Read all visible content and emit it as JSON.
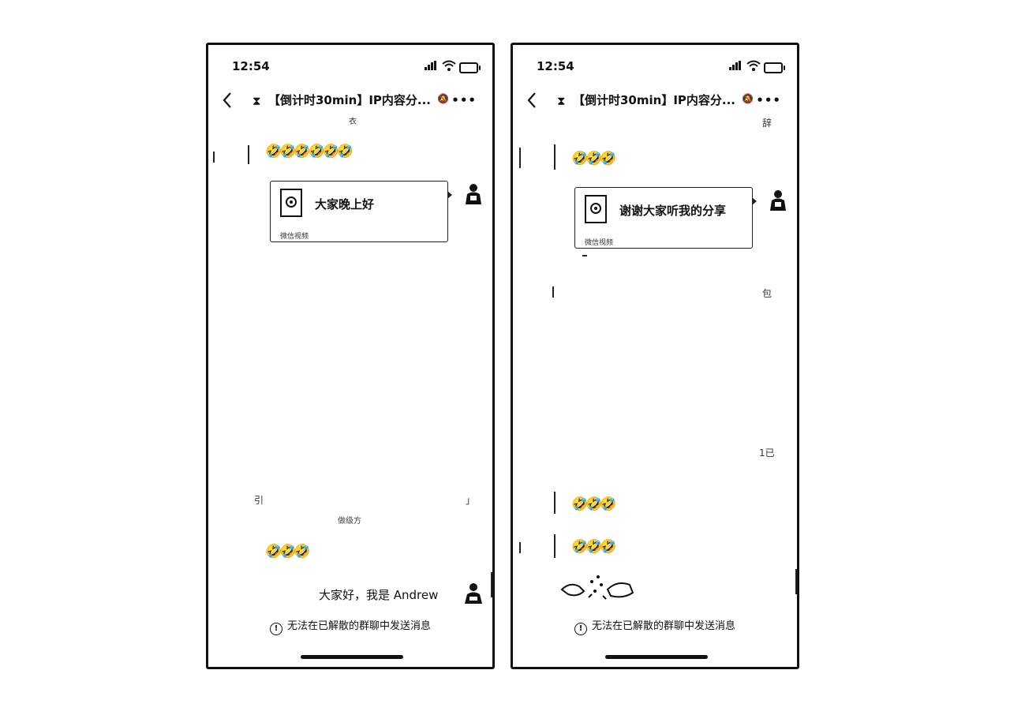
{
  "left": {
    "status": {
      "time": "12:54"
    },
    "header": {
      "title": "【倒计时30min】IP内容分..."
    },
    "fragments": {
      "top": "衣",
      "mid_left": "引",
      "mid_right": "」",
      "sys": "做级方"
    },
    "messages": {
      "emoji_row_1": "🤣🤣🤣🤣🤣🤣",
      "card_title": "大家晚上好",
      "card_source": "微信视频",
      "emoji_row_2": "🤣🤣🤣",
      "text": "大家好，我是 Andrew"
    },
    "notice": "无法在已解散的群聊中发送消息"
  },
  "right": {
    "status": {
      "time": "12:54"
    },
    "header": {
      "title": "【倒计时30min】IP内容分..."
    },
    "fragments": {
      "top": "辞",
      "mid": "包",
      "lower": "1已"
    },
    "messages": {
      "emoji_row_1": "🤣🤣🤣",
      "card_title": "谢谢大家听我的分享",
      "card_source": "微信视频",
      "emoji_row_2": "🤣🤣🤣",
      "emoji_row_3": "🤣🤣🤣"
    },
    "notice": "无法在已解散的群聊中发送消息"
  }
}
